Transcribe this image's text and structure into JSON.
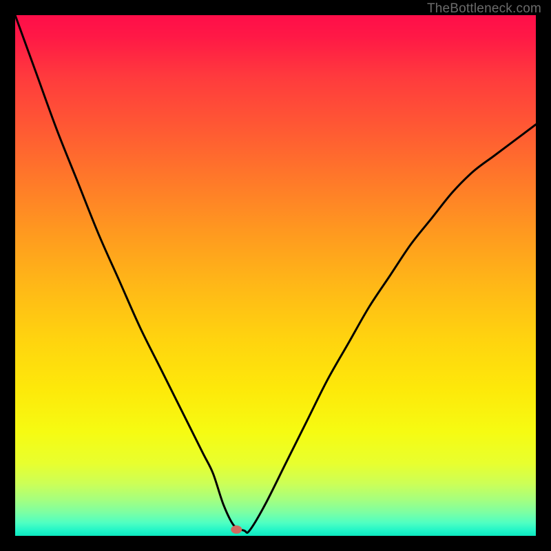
{
  "attribution": "TheBottleneck.com",
  "chart_data": {
    "type": "line",
    "title": "",
    "xlabel": "",
    "ylabel": "",
    "xlim": [
      0,
      100
    ],
    "ylim": [
      0,
      100
    ],
    "grid": false,
    "legend": false,
    "gradient_stops": [
      {
        "pos": 0,
        "color": "#ff0e49"
      },
      {
        "pos": 50,
        "color": "#ffb817"
      },
      {
        "pos": 80,
        "color": "#f6fb12"
      },
      {
        "pos": 100,
        "color": "#0ce8c0"
      }
    ],
    "marker": {
      "x": 42.5,
      "y": 1.2,
      "color": "#d16a5f"
    },
    "series": [
      {
        "name": "curve",
        "color": "#000000",
        "x": [
          0,
          4,
          8,
          12,
          16,
          20,
          24,
          28,
          32,
          36,
          38,
          40,
          42,
          44,
          45,
          48,
          52,
          56,
          60,
          64,
          68,
          72,
          76,
          80,
          84,
          88,
          92,
          96,
          100
        ],
        "values": [
          100,
          89,
          78,
          68,
          58,
          49,
          40,
          32,
          24,
          16,
          12,
          6,
          2,
          1,
          1,
          6,
          14,
          22,
          30,
          37,
          44,
          50,
          56,
          61,
          66,
          70,
          73,
          76,
          79
        ]
      }
    ]
  }
}
